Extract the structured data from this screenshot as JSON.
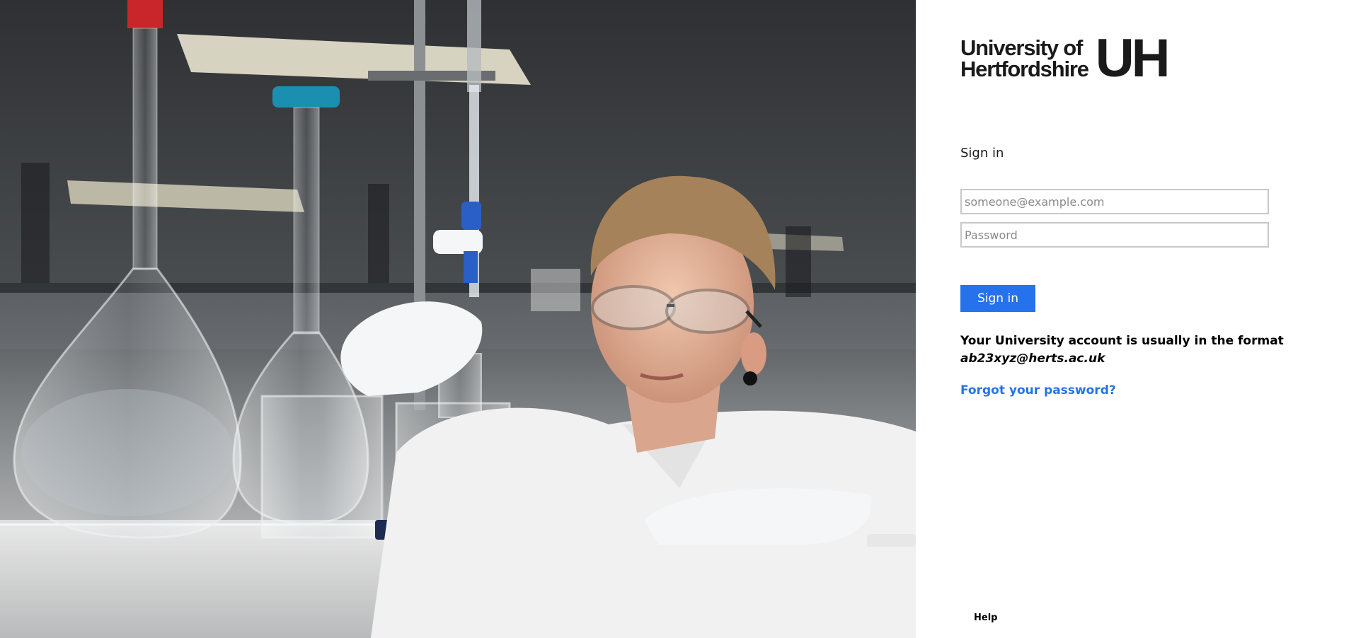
{
  "logo": {
    "line1": "University of",
    "line2": "Hertfordshire",
    "mark": "UH"
  },
  "signin": {
    "heading": "Sign in",
    "email_placeholder": "someone@example.com",
    "password_placeholder": "Password",
    "button_label": "Sign in"
  },
  "hint": {
    "text": "Your University account is usually in the format",
    "format": "ab23xyz@herts.ac.uk"
  },
  "links": {
    "forgot_password": "Forgot your password?",
    "help": "Help"
  },
  "colors": {
    "accent": "#2672ec",
    "text": "#000000",
    "field_border": "#c8c8c8"
  }
}
